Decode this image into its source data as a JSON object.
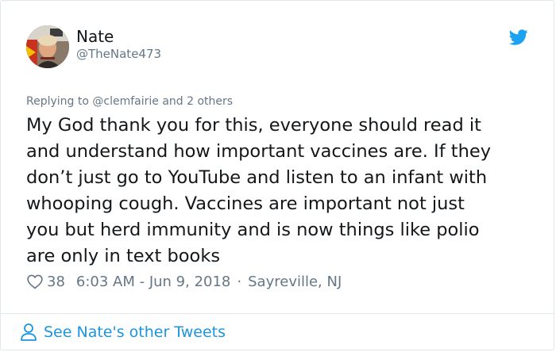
{
  "author": {
    "display_name": "Nate",
    "handle": "@TheNate473"
  },
  "reply_context": "Replying to @clemfairie and 2 others",
  "tweet": {
    "text": "My God thank you for this, everyone should read it\nand understand how important vaccines are. If they\ndon’t just go to YouTube and listen to an infant with\nwhooping cough. Vaccines are important not just\nyou but herd immunity and is now things like polio\nare only in text books"
  },
  "meta": {
    "likes": "38",
    "timestamp": "6:03 AM - Jun 9, 2018",
    "separator": "·",
    "location": "Sayreville, NJ"
  },
  "footer": {
    "link_label": "See Nate's other Tweets"
  },
  "icons": {
    "brand": "twitter-bird-icon",
    "like": "heart-icon",
    "profile": "person-icon"
  },
  "colors": {
    "link": "#1b95e0",
    "brand": "#1da1f2",
    "secondary_text": "#657786",
    "primary_text": "#14171a"
  }
}
